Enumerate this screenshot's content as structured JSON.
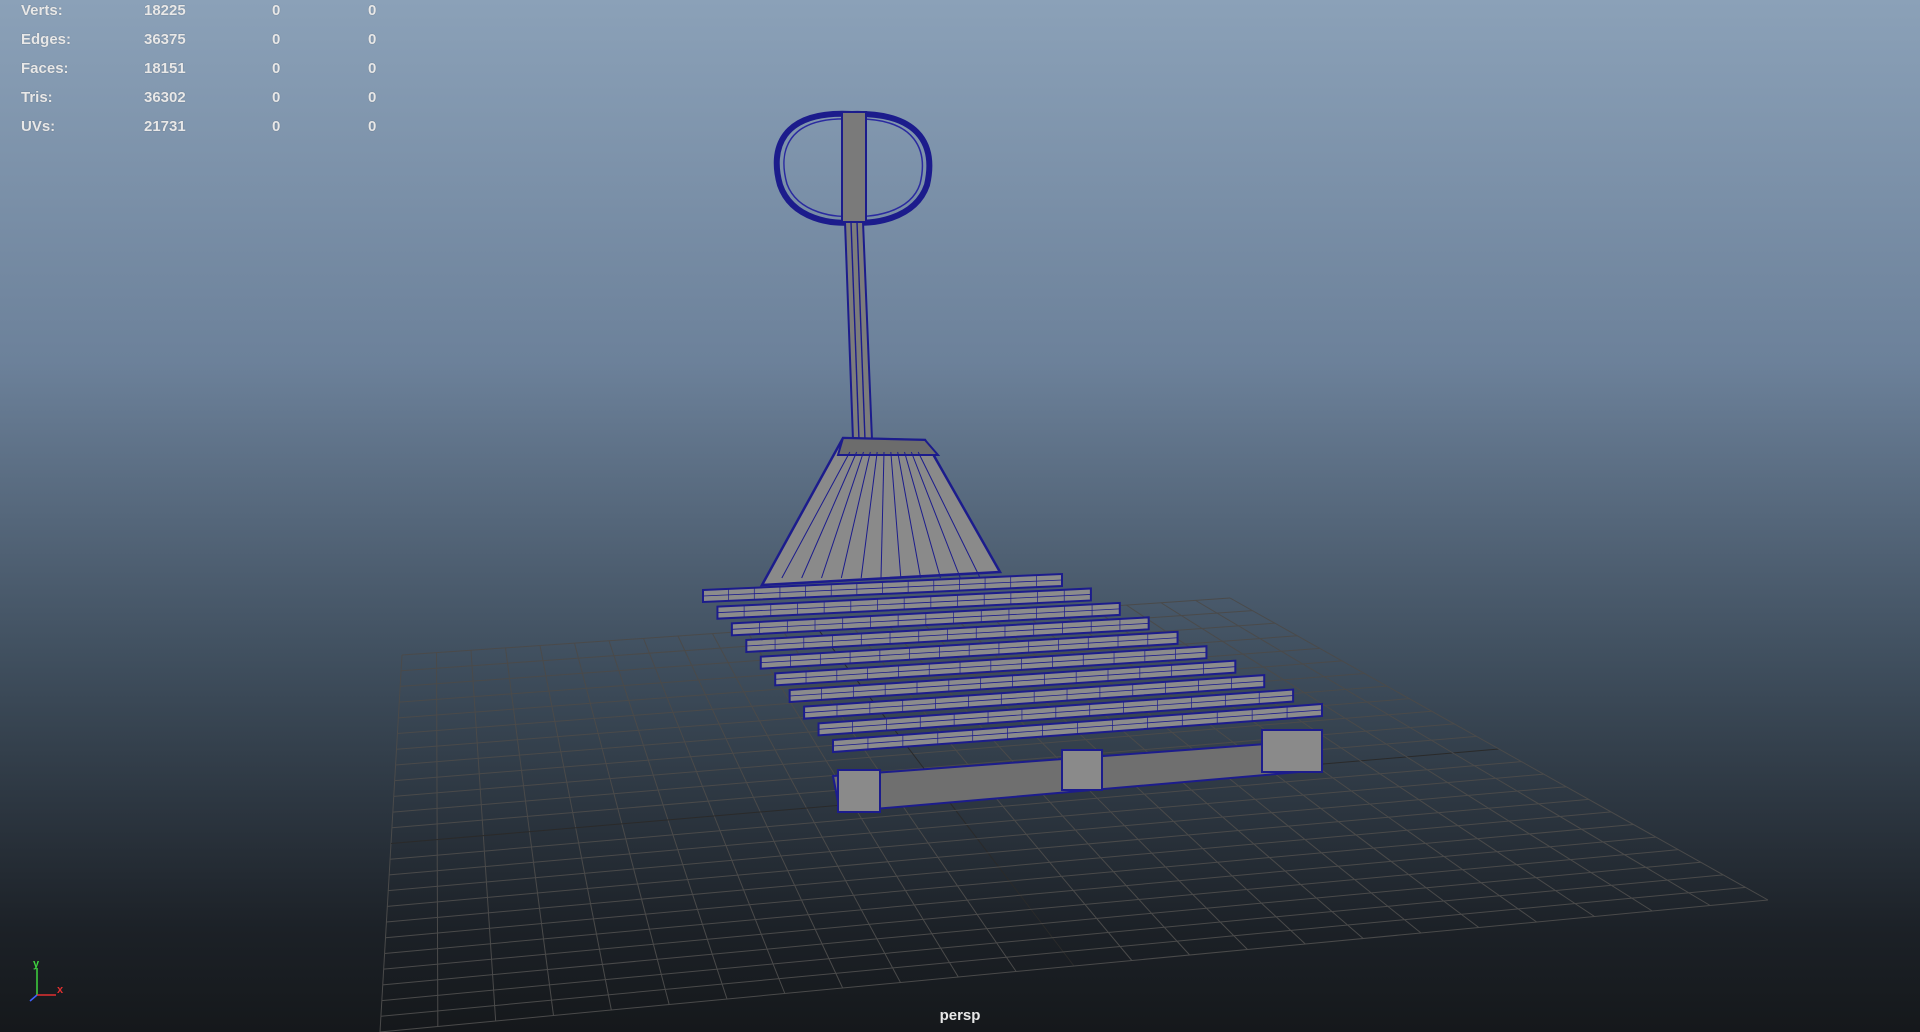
{
  "hud": {
    "rows": [
      {
        "label": "Verts:",
        "v1": "18225",
        "v2": "0",
        "v3": "0"
      },
      {
        "label": "Edges:",
        "v1": "36375",
        "v2": "0",
        "v3": "0"
      },
      {
        "label": "Faces:",
        "v1": "18151",
        "v2": "0",
        "v3": "0"
      },
      {
        "label": "Tris:",
        "v1": "36302",
        "v2": "0",
        "v3": "0"
      },
      {
        "label": "UVs:",
        "v1": "21731",
        "v2": "0",
        "v3": "0"
      }
    ]
  },
  "viewport": {
    "camera_name": "persp",
    "background_top": "#8ba1b8",
    "background_bottom": "#15181b",
    "grid_color": "#4a4a4a",
    "wireframe_color": "#1c1c8c",
    "shaded_color": "#8a8a8a"
  },
  "axis_gizmo": {
    "y_label": "y",
    "x_label": "x",
    "y_color": "#3fd43f",
    "x_color": "#e03030",
    "z_color": "#4060ff"
  }
}
